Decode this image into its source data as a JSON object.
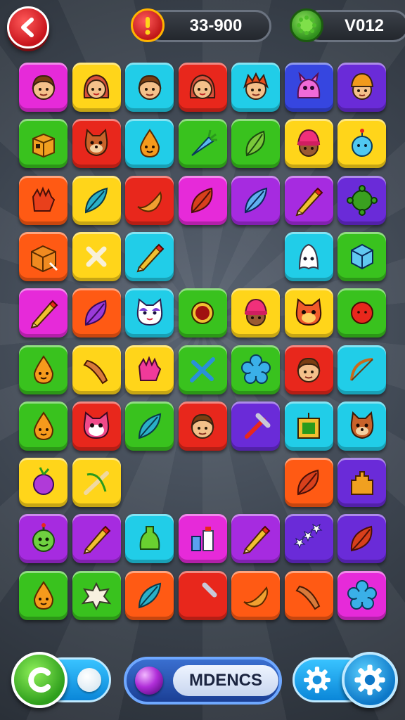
{
  "header": {
    "score": "33-900",
    "level": "V012",
    "back_icon": "chevron-left-icon",
    "score_icon": "alert-icon",
    "level_icon": "gem-icon"
  },
  "footer": {
    "mode_label": "MDENCS",
    "undo_icon": "undo-icon",
    "settings_icon": "gear-icon"
  },
  "colors": {
    "magenta": "#e62ad9",
    "yellow": "#ffd51a",
    "cyan": "#21cde8",
    "red": "#e8271c",
    "blue": "#3646e0",
    "purple": "#6a2bd8",
    "green": "#39c21e",
    "orange": "#ff5a14",
    "violet": "#a62be0"
  },
  "board": {
    "rows": [
      [
        {
          "c": "magenta",
          "i": "face-boy"
        },
        {
          "c": "yellow",
          "i": "face-girl"
        },
        {
          "c": "cyan",
          "i": "face-boy"
        },
        {
          "c": "red",
          "i": "face-girl"
        },
        {
          "c": "cyan",
          "i": "face-redhair"
        },
        {
          "c": "blue",
          "i": "monster"
        },
        {
          "c": "purple",
          "i": "face-hat"
        }
      ],
      [
        {
          "c": "green",
          "i": "box"
        },
        {
          "c": "red",
          "i": "cat"
        },
        {
          "c": "cyan",
          "i": "drop"
        },
        {
          "c": "green",
          "i": "carrot"
        },
        {
          "c": "green",
          "i": "leaf"
        },
        {
          "c": "yellow",
          "i": "face-beanie"
        },
        {
          "c": "yellow",
          "i": "drop-blue"
        }
      ],
      [
        {
          "c": "orange",
          "i": "glove"
        },
        {
          "c": "yellow",
          "i": "feather"
        },
        {
          "c": "red",
          "i": "banana"
        },
        {
          "c": "magenta",
          "i": "leaf-red"
        },
        {
          "c": "violet",
          "i": "feather-blue"
        },
        {
          "c": "violet",
          "i": "pencil"
        },
        {
          "c": "purple",
          "i": "splat"
        }
      ],
      [
        {
          "c": "orange",
          "i": "box-orange"
        },
        {
          "c": "yellow",
          "i": "bone"
        },
        {
          "c": "cyan",
          "i": "pencil"
        },
        null,
        null,
        {
          "c": "cyan",
          "i": "ghost"
        },
        {
          "c": "green",
          "i": "cube"
        }
      ],
      [
        {
          "c": "magenta",
          "i": "pencil"
        },
        {
          "c": "orange",
          "i": "leaf-purple"
        },
        {
          "c": "cyan",
          "i": "cat-white"
        },
        {
          "c": "green",
          "i": "orb"
        },
        {
          "c": "yellow",
          "i": "face-beanie"
        },
        {
          "c": "yellow",
          "i": "cat-red"
        },
        {
          "c": "green",
          "i": "ball-red"
        }
      ],
      [
        {
          "c": "green",
          "i": "drop"
        },
        {
          "c": "yellow",
          "i": "sausage"
        },
        {
          "c": "yellow",
          "i": "glove-pink"
        },
        {
          "c": "green",
          "i": "tools"
        },
        {
          "c": "green",
          "i": "flower"
        },
        {
          "c": "red",
          "i": "face-boy"
        },
        {
          "c": "cyan",
          "i": "bow"
        }
      ],
      [
        {
          "c": "green",
          "i": "drop"
        },
        {
          "c": "red",
          "i": "cat-pink"
        },
        {
          "c": "green",
          "i": "feather"
        },
        {
          "c": "red",
          "i": "face-boy"
        },
        {
          "c": "purple",
          "i": "hammer"
        },
        {
          "c": "cyan",
          "i": "frame"
        },
        {
          "c": "cyan",
          "i": "cat"
        }
      ],
      [
        {
          "c": "yellow",
          "i": "turnip"
        },
        {
          "c": "yellow",
          "i": "bow-knife"
        },
        null,
        null,
        null,
        {
          "c": "orange",
          "i": "leaf-red"
        },
        {
          "c": "purple",
          "i": "castle"
        }
      ],
      [
        {
          "c": "violet",
          "i": "monster-green"
        },
        {
          "c": "violet",
          "i": "pencil"
        },
        {
          "c": "cyan",
          "i": "bottle"
        },
        {
          "c": "magenta",
          "i": "bottles"
        },
        {
          "c": "violet",
          "i": "pencil"
        },
        {
          "c": "purple",
          "i": "stars"
        },
        {
          "c": "purple",
          "i": "leaf-red"
        }
      ],
      [
        {
          "c": "green",
          "i": "drop"
        },
        {
          "c": "green",
          "i": "shell"
        },
        {
          "c": "orange",
          "i": "feather"
        },
        {
          "c": "red",
          "i": "hammer"
        },
        {
          "c": "orange",
          "i": "banana"
        },
        {
          "c": "orange",
          "i": "sausage"
        },
        {
          "c": "magenta",
          "i": "flower"
        }
      ]
    ]
  }
}
